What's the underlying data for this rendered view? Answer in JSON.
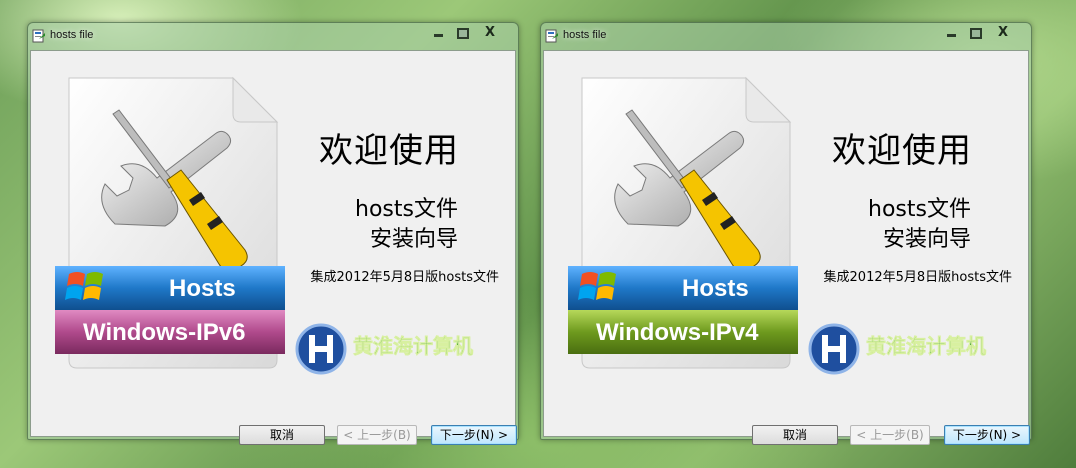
{
  "windows": [
    {
      "title": "hosts file",
      "heading": "欢迎使用",
      "subtitle_line1": "hosts文件",
      "subtitle_line2": "安装向导",
      "note": "集成2012年5月8日版hosts文件",
      "banner_top": "Hosts",
      "banner_bottom": "Windows-IPv6",
      "banner_bottom_color": "#b04a8c",
      "logo_text": "黄淮海计算机",
      "buttons": {
        "cancel": "取消",
        "back": "< 上一步(B)",
        "next": "下一步(N) >"
      }
    },
    {
      "title": "hosts file",
      "heading": "欢迎使用",
      "subtitle_line1": "hosts文件",
      "subtitle_line2": "安装向导",
      "note": "集成2012年5月8日版hosts文件",
      "banner_top": "Hosts",
      "banner_bottom": "Windows-IPv4",
      "banner_bottom_color": "#6e9a1e",
      "logo_text": "黄淮海计算机",
      "buttons": {
        "cancel": "取消",
        "back": "< 上一步(B)",
        "next": "下一步(N) >"
      }
    }
  ],
  "colors": {
    "banner_top_blue": "#1f78c8",
    "ipv6_magenta": "#b04a8c",
    "ipv4_green": "#6e9a1e",
    "default_button_border": "#3c7fb1"
  },
  "icons": {
    "app": "installer-icon",
    "art": "wrench-screwdriver-icon",
    "flag": "windows-flag-icon",
    "logo": "h-logo-icon"
  }
}
